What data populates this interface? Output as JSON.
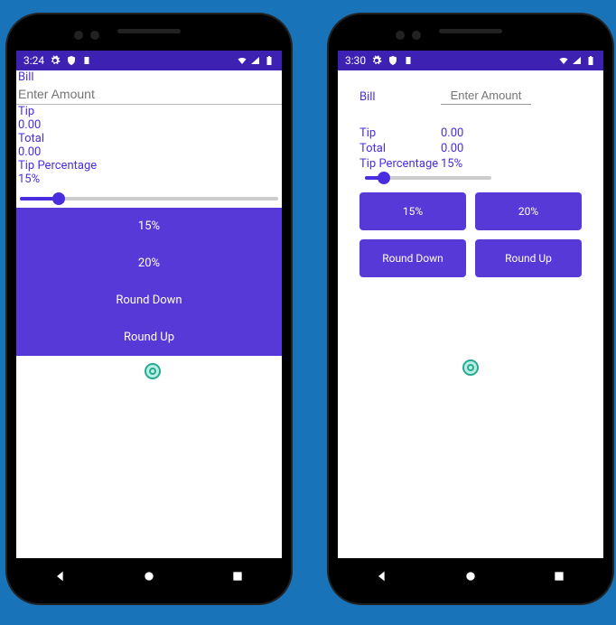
{
  "left": {
    "status_time": "3:24",
    "bill_label": "Bill",
    "amount_placeholder": "Enter Amount",
    "amount_value": "",
    "tip_label": "Tip",
    "tip_value": "0.00",
    "total_label": "Total",
    "total_value": "0.00",
    "tip_pct_label": "Tip Percentage",
    "tip_pct_value": "15%",
    "slider_pct": 15,
    "buttons": {
      "b15": "15%",
      "b20": "20%",
      "round_down": "Round Down",
      "round_up": "Round Up"
    }
  },
  "right": {
    "status_time": "3:30",
    "bill_label": "Bill",
    "amount_placeholder": "Enter Amount",
    "amount_value": "",
    "tip_label": "Tip",
    "tip_value": "0.00",
    "total_label": "Total",
    "total_value": "0.00",
    "tip_pct_label": "Tip Percentage",
    "tip_pct_value": "15%",
    "slider_pct": 15,
    "buttons": {
      "b15": "15%",
      "b20": "20%",
      "round_down": "Round Down",
      "round_up": "Round Up"
    }
  },
  "colors": {
    "primary": "#5639d6",
    "accent_text": "#4b2de0",
    "statusbar": "#3d21b3"
  }
}
